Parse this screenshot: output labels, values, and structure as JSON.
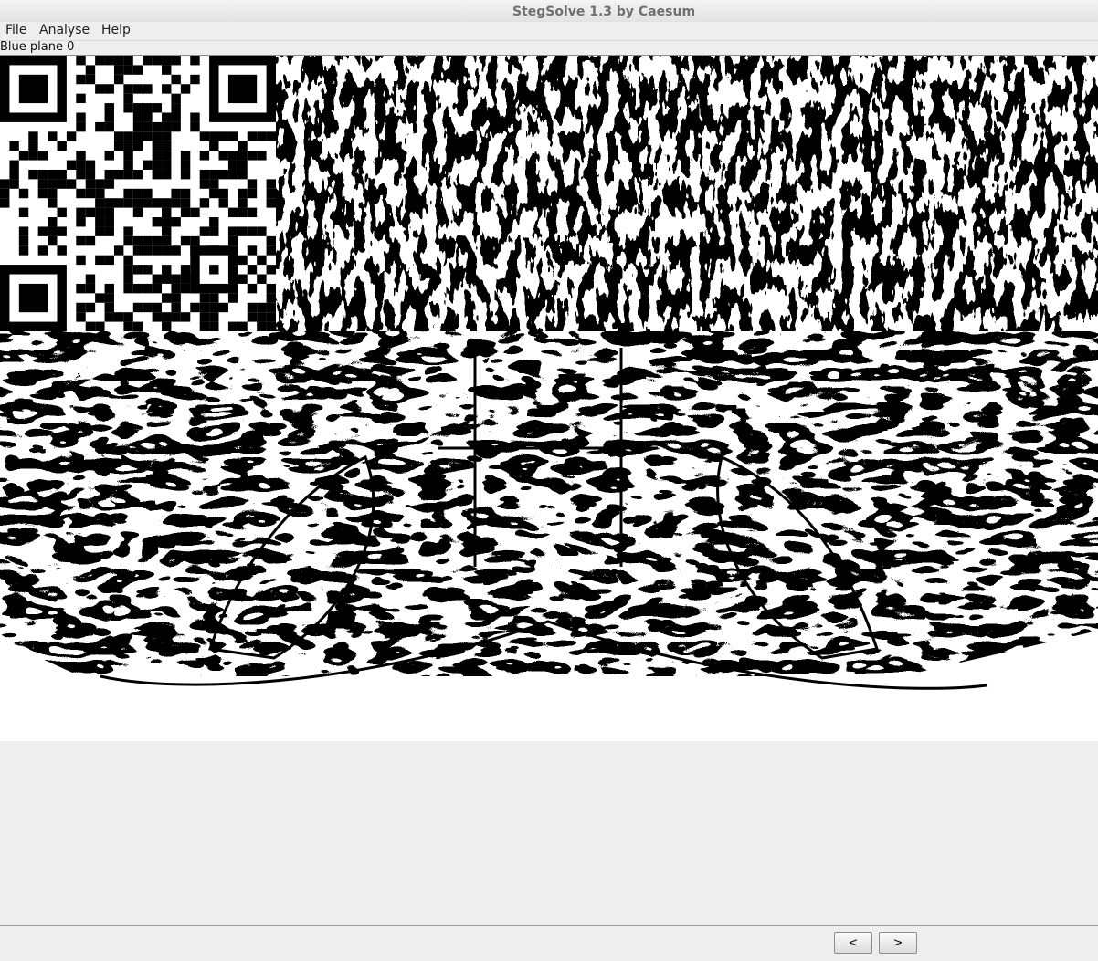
{
  "window": {
    "title": "StegSolve 1.3 by Caesum"
  },
  "menu": {
    "items": [
      "File",
      "Analyse",
      "Help"
    ]
  },
  "status": {
    "text": "Blue plane 0"
  },
  "image": {
    "description_icon": "bitplane-image",
    "qr_icon": "qr-code-icon"
  },
  "nav": {
    "prev_label": "<",
    "next_label": ">"
  }
}
